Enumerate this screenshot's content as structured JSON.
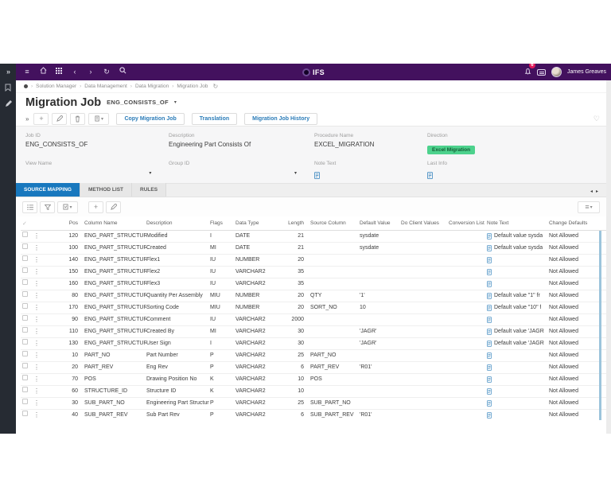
{
  "glyphs": {
    "double_chevron": "»",
    "hamburger": "≡",
    "chevron_left": "‹",
    "chevron_right": "›",
    "refresh": "↻",
    "kebab": "⋮",
    "caret_down": "▾",
    "heart": "♡",
    "check": "✓",
    "plus": "+",
    "crumb_sep": "›",
    "tab_left": "◂",
    "tab_right": "▸"
  },
  "topbar": {
    "brand": "IFS",
    "user_name": "James Greaves",
    "notification_count": "6"
  },
  "breadcrumb": {
    "items": [
      "Solution Manager",
      "Data Management",
      "Data Migration",
      "Migration Job"
    ]
  },
  "page": {
    "title": "Migration Job",
    "subtitle": "ENG_CONSISTS_OF"
  },
  "toolbar": {
    "buttons": [
      "Copy Migration Job",
      "Translation",
      "Migration Job History"
    ]
  },
  "form": {
    "fields": [
      {
        "label": "Job ID",
        "value": "ENG_CONSISTS_OF"
      },
      {
        "label": "Description",
        "value": "Engineering Part Consists Of"
      },
      {
        "label": "Procedure Name",
        "value": "EXCEL_MIGRATION"
      },
      {
        "label": "Direction",
        "value": "Excel Migration"
      },
      {
        "label": "View Name",
        "value": ""
      },
      {
        "label": "Group ID",
        "value": ""
      },
      {
        "label": "Note Text",
        "value": ""
      },
      {
        "label": "Last Info",
        "value": ""
      }
    ]
  },
  "tabs": [
    {
      "label": "SOURCE MAPPING",
      "active": true
    },
    {
      "label": "METHOD LIST",
      "active": false
    },
    {
      "label": "RULES",
      "active": false
    }
  ],
  "table": {
    "columns": [
      "Pos",
      "Column Name",
      "Description",
      "Flags",
      "Data Type",
      "Length",
      "Source Column",
      "Default Value",
      "Do Client Values",
      "Conversion List",
      "Note Text",
      "Change Defaults"
    ],
    "rows": [
      {
        "pos": "120",
        "column_name": "ENG_PART_STRUCTURE_I",
        "description": "Modified",
        "flags": "I",
        "data_type": "DATE",
        "length": "21",
        "source_column": "",
        "default_value": "sysdate",
        "do_client_values": "",
        "conversion_list": "",
        "note_text": "Default value sysda",
        "change_defaults": "Not Allowed"
      },
      {
        "pos": "100",
        "column_name": "ENG_PART_STRUCTURE_I",
        "description": "Created",
        "flags": "MI",
        "data_type": "DATE",
        "length": "21",
        "source_column": "",
        "default_value": "sysdate",
        "do_client_values": "",
        "conversion_list": "",
        "note_text": "Default value sysda",
        "change_defaults": "Not Allowed"
      },
      {
        "pos": "140",
        "column_name": "ENG_PART_STRUCTURE_I",
        "description": "Flex1",
        "flags": "IU",
        "data_type": "NUMBER",
        "length": "20",
        "source_column": "",
        "default_value": "",
        "do_client_values": "",
        "conversion_list": "",
        "note_text": "",
        "change_defaults": "Not Allowed"
      },
      {
        "pos": "150",
        "column_name": "ENG_PART_STRUCTURE_I",
        "description": "Flex2",
        "flags": "IU",
        "data_type": "VARCHAR2",
        "length": "35",
        "source_column": "",
        "default_value": "",
        "do_client_values": "",
        "conversion_list": "",
        "note_text": "",
        "change_defaults": "Not Allowed"
      },
      {
        "pos": "160",
        "column_name": "ENG_PART_STRUCTURE_I",
        "description": "Flex3",
        "flags": "IU",
        "data_type": "VARCHAR2",
        "length": "35",
        "source_column": "",
        "default_value": "",
        "do_client_values": "",
        "conversion_list": "",
        "note_text": "",
        "change_defaults": "Not Allowed"
      },
      {
        "pos": "80",
        "column_name": "ENG_PART_STRUCTURE_I",
        "description": "Quantity Per Assembly",
        "flags": "MIU",
        "data_type": "NUMBER",
        "length": "20",
        "source_column": "QTY",
        "default_value": "'1'",
        "do_client_values": "",
        "conversion_list": "",
        "note_text": "Default value \"1\" fr",
        "change_defaults": "Not Allowed"
      },
      {
        "pos": "170",
        "column_name": "ENG_PART_STRUCTURE_I",
        "description": "Sorting Code",
        "flags": "MIU",
        "data_type": "NUMBER",
        "length": "20",
        "source_column": "SORT_NO",
        "default_value": "10",
        "do_client_values": "",
        "conversion_list": "",
        "note_text": "Default value \"10\" f",
        "change_defaults": "Not Allowed"
      },
      {
        "pos": "90",
        "column_name": "ENG_PART_STRUCTURE_I",
        "description": "Comment",
        "flags": "IU",
        "data_type": "VARCHAR2",
        "length": "2000",
        "source_column": "",
        "default_value": "",
        "do_client_values": "",
        "conversion_list": "",
        "note_text": "",
        "change_defaults": "Not Allowed"
      },
      {
        "pos": "110",
        "column_name": "ENG_PART_STRUCTURE_I",
        "description": "Created By",
        "flags": "MI",
        "data_type": "VARCHAR2",
        "length": "30",
        "source_column": "",
        "default_value": "'JAGR'",
        "do_client_values": "",
        "conversion_list": "",
        "note_text": "Default value 'JAGR",
        "change_defaults": "Not Allowed"
      },
      {
        "pos": "130",
        "column_name": "ENG_PART_STRUCTURE_I",
        "description": "User Sign",
        "flags": "I",
        "data_type": "VARCHAR2",
        "length": "30",
        "source_column": "",
        "default_value": "'JAGR'",
        "do_client_values": "",
        "conversion_list": "",
        "note_text": "Default value 'JAGR",
        "change_defaults": "Not Allowed"
      },
      {
        "pos": "10",
        "column_name": "PART_NO",
        "description": "Part Number",
        "flags": "P",
        "data_type": "VARCHAR2",
        "length": "25",
        "source_column": "PART_NO",
        "default_value": "",
        "do_client_values": "",
        "conversion_list": "",
        "note_text": "",
        "change_defaults": "Not Allowed"
      },
      {
        "pos": "20",
        "column_name": "PART_REV",
        "description": "Eng Rev",
        "flags": "P",
        "data_type": "VARCHAR2",
        "length": "6",
        "source_column": "PART_REV",
        "default_value": "'R01'",
        "do_client_values": "",
        "conversion_list": "",
        "note_text": "",
        "change_defaults": "Not Allowed"
      },
      {
        "pos": "70",
        "column_name": "POS",
        "description": "Drawing Position No",
        "flags": "K",
        "data_type": "VARCHAR2",
        "length": "10",
        "source_column": "POS",
        "default_value": "",
        "do_client_values": "",
        "conversion_list": "",
        "note_text": "",
        "change_defaults": "Not Allowed"
      },
      {
        "pos": "60",
        "column_name": "STRUCTURE_ID",
        "description": "Structure ID",
        "flags": "K",
        "data_type": "VARCHAR2",
        "length": "10",
        "source_column": "",
        "default_value": "",
        "do_client_values": "",
        "conversion_list": "",
        "note_text": "",
        "change_defaults": "Not Allowed"
      },
      {
        "pos": "30",
        "column_name": "SUB_PART_NO",
        "description": "Engineering Part Structur",
        "flags": "P",
        "data_type": "VARCHAR2",
        "length": "25",
        "source_column": "SUB_PART_NO",
        "default_value": "",
        "do_client_values": "",
        "conversion_list": "",
        "note_text": "",
        "change_defaults": "Not Allowed"
      },
      {
        "pos": "40",
        "column_name": "SUB_PART_REV",
        "description": "Sub Part Rev",
        "flags": "P",
        "data_type": "VARCHAR2",
        "length": "6",
        "source_column": "SUB_PART_REV",
        "default_value": "'R01'",
        "do_client_values": "",
        "conversion_list": "",
        "note_text": "",
        "change_defaults": "Not Allowed"
      }
    ]
  },
  "colors": {
    "topbar_purple": "#43115e",
    "active_tab_blue": "#1878be",
    "badge_green": "#4dd28d",
    "link_blue": "#2b7cb8",
    "notification_red": "#e0195a",
    "note_icon_blue": "#4a90c4"
  }
}
